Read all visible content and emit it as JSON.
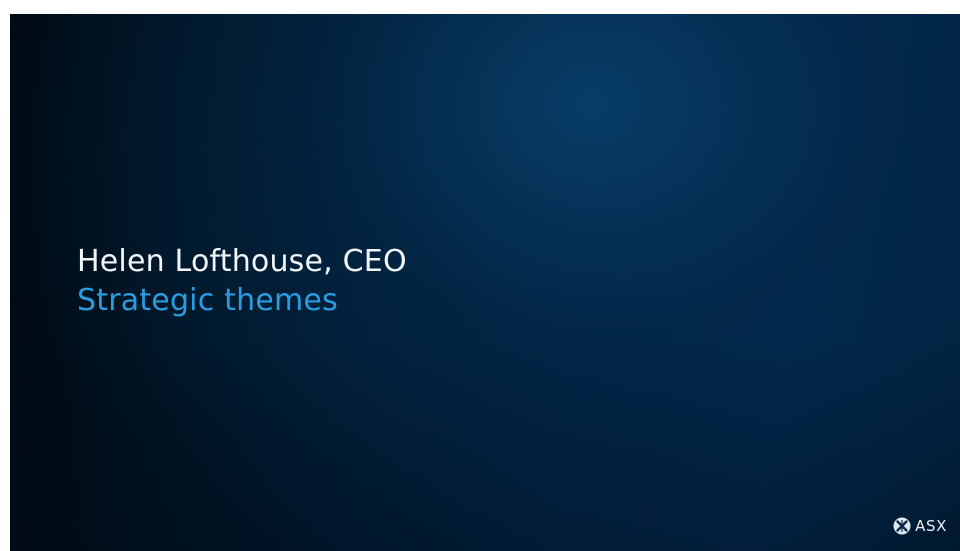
{
  "slide": {
    "presenter": "Helen Lofthouse, CEO",
    "subtitle": "Strategic themes"
  },
  "logo": {
    "icon": "asx-logo-mark",
    "text": "ASX"
  },
  "colors": {
    "background_dark": "#00080f",
    "background_light": "#012a50",
    "presenter_text": "#f2f6fa",
    "subtitle_accent": "#2a9de0"
  }
}
